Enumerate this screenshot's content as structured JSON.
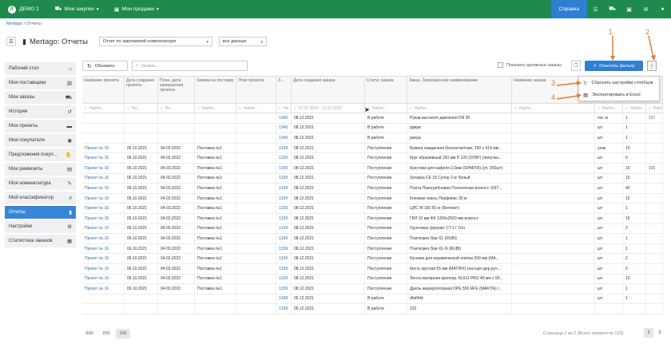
{
  "topbar": {
    "brand": "ДЕМО 2",
    "nav": [
      {
        "label": "Мои закупки",
        "icon": "cart-icon"
      },
      {
        "label": "Мои продажи",
        "icon": "shop-icon"
      }
    ],
    "help_label": "Справка",
    "accent": "#1e8a4c",
    "help_color": "#2f7fd3"
  },
  "breadcrumb": {
    "root": "Mertago",
    "sep": "/",
    "current": "Отчеты"
  },
  "title": {
    "text": "Mertago: Отчеты",
    "report_select": "Отчет по закупаемой номенклатуре",
    "data_select": "все данные"
  },
  "sidebar": {
    "items": [
      {
        "label": "Рабочий стол",
        "icon": "home-icon",
        "glyph": "⌂"
      },
      {
        "label": "Мои поставщики",
        "icon": "building-icon",
        "glyph": "▥"
      },
      {
        "label": "Мои заказы",
        "icon": "cart-icon",
        "glyph": "⛟"
      },
      {
        "label": "История",
        "icon": "history-icon",
        "glyph": "↺"
      },
      {
        "label": "Мои проекты",
        "icon": "briefcase-icon",
        "glyph": "▬"
      },
      {
        "label": "Мои покупатели",
        "icon": "eye-icon",
        "glyph": "◉"
      },
      {
        "label": "Предложения покуп...",
        "icon": "handshake-icon",
        "glyph": "✋"
      },
      {
        "label": "Мои реквизиты",
        "icon": "id-card-icon",
        "glyph": "▤"
      },
      {
        "label": "Моя номенклатура",
        "icon": "tags-icon",
        "glyph": "✎"
      },
      {
        "label": "Мой классификатор",
        "icon": "hash-icon",
        "glyph": "#"
      },
      {
        "label": "Отчеты",
        "icon": "file-icon",
        "glyph": "▮",
        "active": true
      },
      {
        "label": "Настройки",
        "icon": "gears-icon",
        "glyph": "⚙"
      },
      {
        "label": "Статистика заказов",
        "icon": "chart-icon",
        "glyph": "▦"
      }
    ]
  },
  "toolbar": {
    "refresh_label": "Обновить",
    "search_placeholder": "Искать...",
    "archive_label": "Показать архивные заказы",
    "clear_filter_label": "Очистить фильтр"
  },
  "columns": [
    "Название проекта",
    "Дата создания проекта",
    "План. дата завершения проекта",
    "Заявка на поставку",
    "Этап проекта",
    "З...",
    "Дата создания заказа",
    "Статус заказа",
    "Заказ. Запрошенное наименование",
    "Название заказа",
    "",
    "",
    ""
  ],
  "filters": {
    "find": "Найти...",
    "find_short": "На...",
    "date_range": "07.07.2020 - 13.12.2021"
  },
  "rows": [
    [
      "",
      "",
      "",
      "",
      "",
      "1340",
      "08.12.2021",
      "В работе",
      "Рукав высокого давления DN 30",
      "",
      "пог. м",
      "1",
      "157"
    ],
    [
      "",
      "",
      "",
      "",
      "",
      "1340",
      "08.12.2021",
      "В работе",
      "ррврв",
      "",
      "шт",
      "1",
      ""
    ],
    [
      "",
      "",
      "",
      "",
      "",
      "1340",
      "08.12.2021",
      "В работе",
      "раора",
      "",
      "шт",
      "1",
      ""
    ],
    [
      "Проект № 16",
      "06.10.2021",
      "04.03.2022",
      "Поставка №1",
      "",
      "1339",
      "08.12.2021",
      "Поступление",
      "Бумага наждачная бесконтактная, 100 х 914 мм...",
      "",
      "упак",
      "10",
      ""
    ],
    [
      "Проект № 16",
      "06.10.2021",
      "04.03.2022",
      "Поставка №1",
      "",
      "1339",
      "08.12.2021",
      "Поступление",
      "Круг абразивный 150 мм Р 120 (3УБР) (липучка...",
      "",
      "шт",
      "6",
      ""
    ],
    [
      "Проект № 16",
      "06.10.2021",
      "04.03.2022",
      "Поставка №1",
      "",
      "1339",
      "08.12.2021",
      "Поступление",
      "Крестики для кафеля 2,0мм (SPARTA) (уп. 250шт)",
      "",
      "шт",
      "15",
      "155"
    ],
    [
      "Проект № 16",
      "06.10.2021",
      "04.03.2022",
      "Поставка №1",
      "",
      "1339",
      "08.12.2021",
      "Поступление",
      "Затирка CE 33 Супер 2 кг белый",
      "",
      "шт",
      "15",
      ""
    ],
    [
      "Проект № 16",
      "06.10.2021",
      "04.03.2022",
      "Поставка №1",
      "",
      "1339",
      "08.12.2021",
      "Поступление",
      "Плита Пазогребневая Полнотелая влагост. (667...",
      "",
      "шт",
      "40",
      ""
    ],
    [
      "Проект № 16",
      "06.10.2021",
      "04.03.2022",
      "Поставка №1",
      "",
      "1339",
      "08.12.2021",
      "Поступление",
      "Клеевая смесь Перфликс 30 кг",
      "",
      "шт",
      "15",
      ""
    ],
    [
      "Проект № 16",
      "06.10.2021",
      "04.03.2022",
      "Поставка №1",
      "",
      "1339",
      "08.12.2021",
      "Поступление",
      "ЦПС М 150 50 кг (Бетонит)",
      "",
      "шт",
      "1",
      ""
    ],
    [
      "Проект № 16",
      "06.10.2021",
      "04.03.2022",
      "Поставка №1",
      "",
      "1339",
      "08.12.2021",
      "Поступление",
      "ГВЛ 10 мм ФК 1200х2500 мм влагост.",
      "",
      "шт",
      "15",
      ""
    ],
    [
      "Проект № 16",
      "06.10.2021",
      "04.03.2022",
      "Поставка №1",
      "",
      "1339",
      "08.12.2021",
      "Поступление",
      "Грунтовка Церезит CT-17 10л",
      "",
      "шт",
      "2",
      ""
    ],
    [
      "Проект № 16",
      "06.10.2021",
      "04.03.2022",
      "Поставка №1",
      "",
      "1339",
      "08.12.2021",
      "Поступление",
      "Плиткорез Star-51 (RUBI)",
      "",
      "шт",
      "1",
      ""
    ],
    [
      "Проект № 16",
      "06.10.2021",
      "04.03.2022",
      "Поставка №1",
      "",
      "1339",
      "08.12.2021",
      "Поступление",
      "Плиткорез Star-61-N (RUBI)",
      "",
      "шт",
      "1",
      ""
    ],
    [
      "Проект № 16",
      "06.10.2021",
      "04.03.2022",
      "Поставка №1",
      "",
      "1339",
      "08.12.2021",
      "Поступление",
      "Кусачки для керамической плитки 200 мм (MA...",
      "",
      "шт",
      "2",
      ""
    ],
    [
      "Проект № 16",
      "06.10.2021",
      "04.03.2022",
      "Поставка №1",
      "",
      "1339",
      "08.12.2021",
      "Поступление",
      "Кисть круглая 55 мм (MATRIX) (нат.щет.дер.руч...",
      "",
      "шт",
      "5",
      ""
    ],
    [
      "Проект № 16",
      "06.10.2021",
      "04.03.2022",
      "Поставка №1",
      "",
      "1339",
      "08.12.2021",
      "Поступление",
      "Лента малярная креппнр. KLEO PRO 48 мм х 50...",
      "",
      "шт",
      "10",
      ""
    ],
    [
      "Проект № 16",
      "06.10.2021",
      "04.03.2022",
      "Поставка №1",
      "",
      "1339",
      "08.12.2021",
      "Поступление",
      "Дрель аккумуляторная DPE 550 RFE (MAKITA) /...",
      "",
      "шт",
      "1",
      ""
    ],
    [
      "",
      "",
      "",
      "",
      "",
      "1338",
      "05.12.2021",
      "В работе",
      "dhdfhfd",
      "",
      "шт",
      "1",
      ""
    ],
    [
      "",
      "",
      "",
      "",
      "",
      "1338",
      "05.12.2021",
      "В работе",
      "222",
      "",
      "",
      "",
      ""
    ]
  ],
  "dropdown": {
    "items": [
      {
        "label": "Сбросить настройки столбцов",
        "icon": "refresh-icon"
      },
      {
        "label": "Экспортировать в Excel",
        "icon": "excel-icon"
      }
    ]
  },
  "annotations": [
    "1",
    "2",
    "3",
    "4"
  ],
  "pager": {
    "sizes": [
      "500",
      "250",
      "100"
    ],
    "info": "Страница 1 из 2 (Всего элементов 133)",
    "pages": [
      "1",
      "2"
    ]
  }
}
